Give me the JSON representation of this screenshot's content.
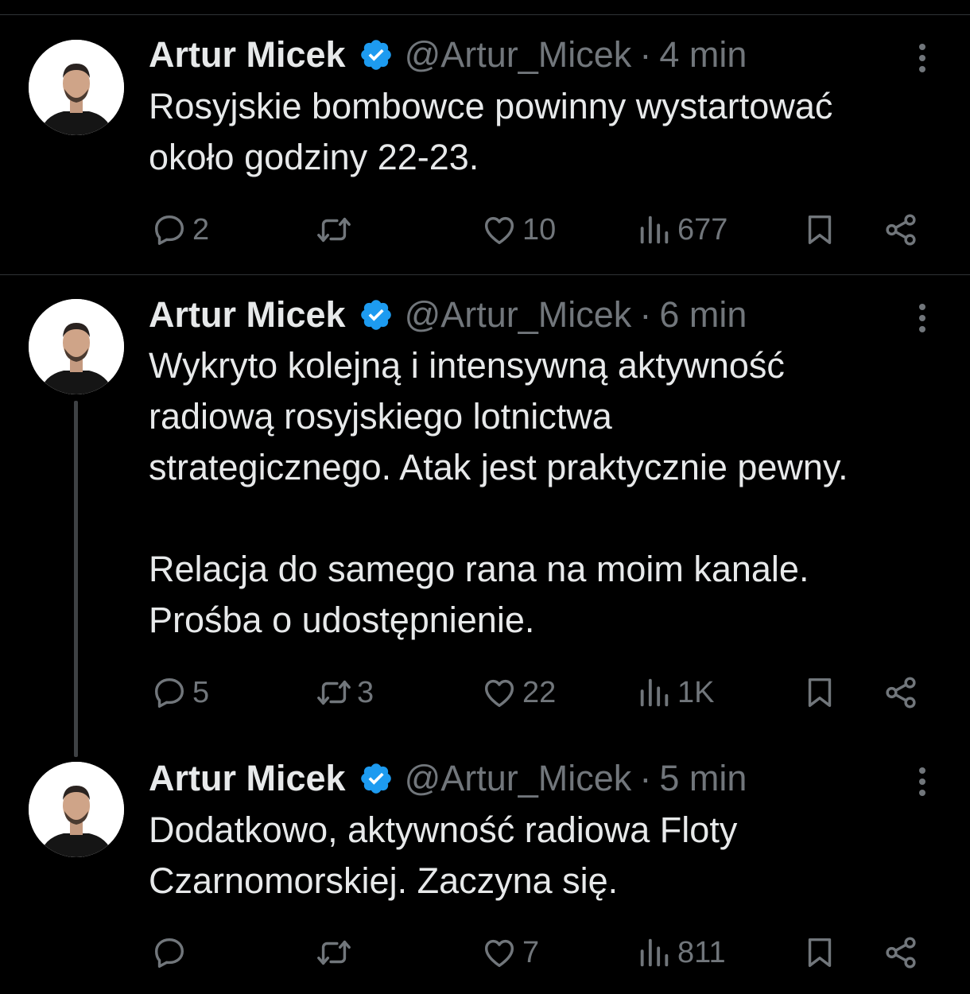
{
  "tweets": [
    {
      "author": "Artur Micek",
      "handle": "@Artur_Micek",
      "separator": "·",
      "time": "4 min",
      "lines": [
        "Rosyjskie bombowce powinny wystartować",
        "około godziny 22-23."
      ],
      "replies": "2",
      "retweets": "",
      "likes": "10",
      "views": "677"
    },
    {
      "author": "Artur Micek",
      "handle": "@Artur_Micek",
      "separator": "·",
      "time": "6 min",
      "lines": [
        "Wykryto kolejną i intensywną aktywność",
        "radiową rosyjskiego lotnictwa",
        "strategicznego. Atak jest praktycznie pewny.",
        "Relacja do samego rana na moim kanale.",
        "Prośba o udostępnienie."
      ],
      "replies": "5",
      "retweets": "3",
      "likes": "22",
      "views": "1K"
    },
    {
      "author": "Artur Micek",
      "handle": "@Artur_Micek",
      "separator": "·",
      "time": "5 min",
      "lines": [
        "Dodatkowo, aktywność radiowa Floty",
        "Czarnomorskiej. Zaczyna się."
      ],
      "replies": "",
      "retweets": "",
      "likes": "7",
      "views": "811"
    }
  ],
  "colors": {
    "background": "#000000",
    "text": "#e7e9ea",
    "secondary": "#71767b",
    "verified": "#1d9bf0",
    "divider": "#2f3336"
  },
  "icons": [
    "reply-icon",
    "retweet-icon",
    "like-icon",
    "views-icon",
    "bookmark-icon",
    "share-icon",
    "verified-badge-icon",
    "more-icon"
  ]
}
